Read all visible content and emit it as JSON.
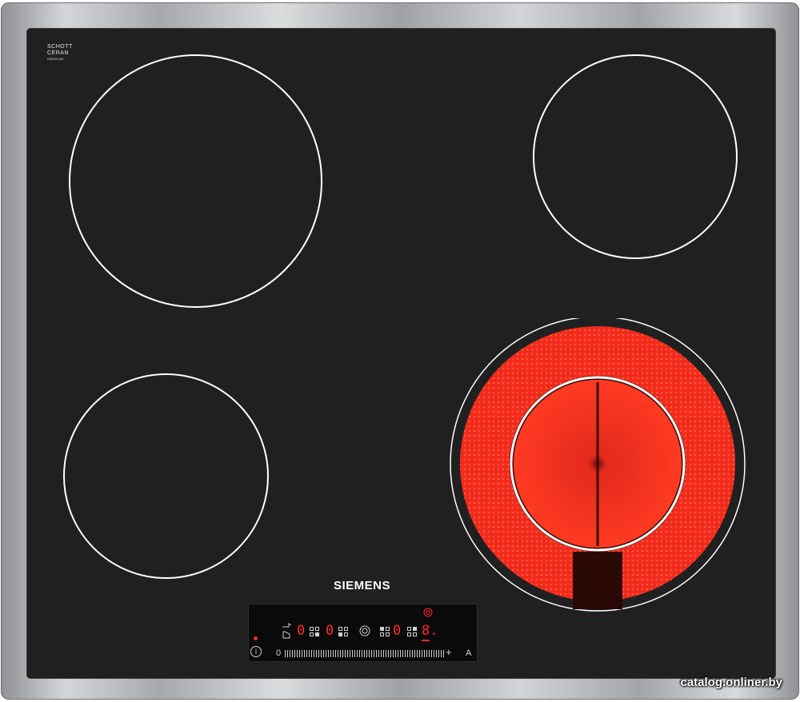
{
  "product": {
    "glass_brand_lines": [
      "SCHOTT",
      "CERAN"
    ],
    "glass_code": "H00001183",
    "brand": "SIEMENS"
  },
  "zones": [
    {
      "id": "front-left-large",
      "state": "off"
    },
    {
      "id": "rear-right-small",
      "state": "off"
    },
    {
      "id": "rear-left-small",
      "state": "off"
    },
    {
      "id": "front-right-dual",
      "state": "on",
      "glow_color": "#ff2a1a"
    }
  ],
  "control_panel": {
    "displays": [
      "0",
      "0",
      "0",
      "8."
    ],
    "power_symbol": "I",
    "slider_min_label": "0",
    "slider_plus_label": "+",
    "auto_label": "A",
    "indicator_color": "#ff2a2a"
  },
  "watermark": "catalog.onliner.by",
  "colors": {
    "glass": "#202020",
    "zone_ring": "#ffffff",
    "display_red": "#ff2a2a"
  }
}
